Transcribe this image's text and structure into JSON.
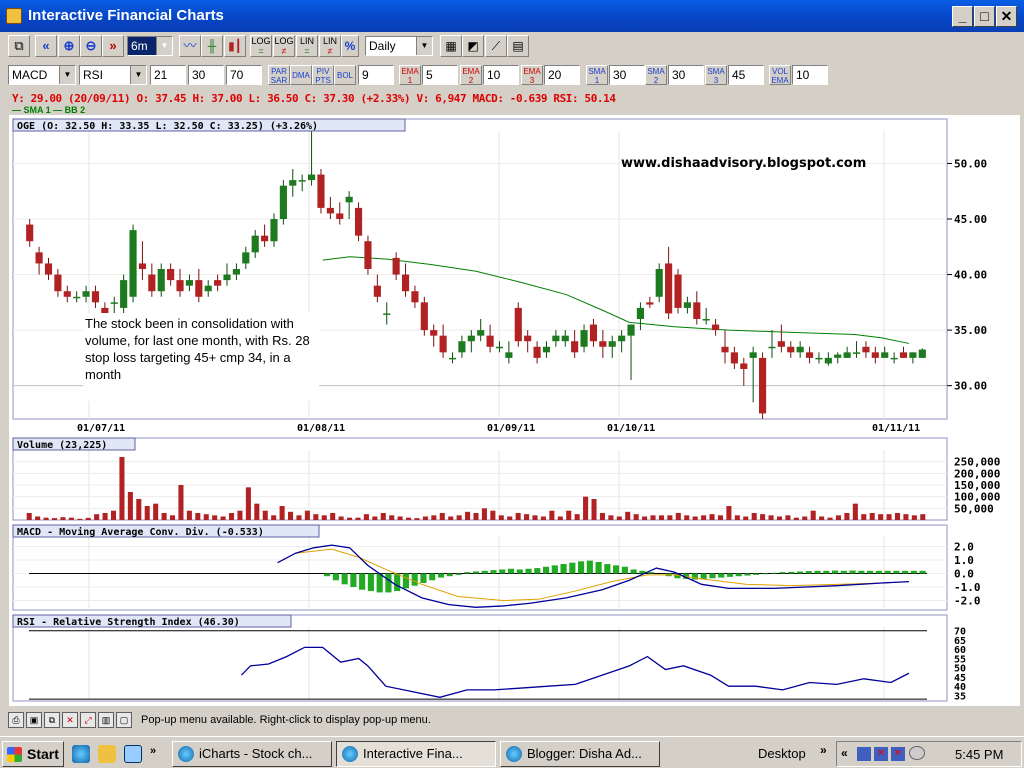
{
  "window": {
    "title": "Interactive Financial Charts"
  },
  "toolbar1": {
    "period": "6m",
    "frequency": "Daily",
    "log_label": "LOG",
    "lin_label": "LIN"
  },
  "toolbar2": {
    "indicator1": "MACD",
    "indicator2": "RSI",
    "macd_params": [
      "21",
      "30",
      "70"
    ],
    "par_sar": "PAR SAR",
    "dma": "DMA",
    "piv_pts": "PIV PTS",
    "bol": "BOL",
    "bol_value": "9",
    "ema1": "EMA 1",
    "ema1_value": "5",
    "ema2": "EMA 2",
    "ema2_value": "10",
    "ema3": "EMA 3",
    "ema3_value": "20",
    "sma1": "SMA 1",
    "sma1_value": "30",
    "sma2": "SMA 2",
    "sma2_value": "30",
    "sma3": "SMA 3",
    "sma3_value": "45",
    "vol_ema": "VOL EMA",
    "vol_ema_value": "10"
  },
  "quote_line": "Y: 29.00 (20/09/11) O: 37.45 H: 37.00 L: 36.50 C: 37.30 (+2.33%) V: 6,947 MACD: -0.639 RSI: 50.14",
  "ma_legend": "— SMA 1 — BB 2",
  "price_panel": {
    "label": "OGE (O: 32.50  H: 33.35  L: 32.50  C: 33.25) (+3.26%)",
    "annotation_url": "www.dishaadvisory.blogspot.com",
    "annotation_note": "The stock been in consolidation with volume, for last one month, with Rs. 28 stop loss targeting 45+ cmp 34, in a month",
    "y_ticks": [
      "50.00",
      "45.00",
      "40.00",
      "35.00",
      "30.00"
    ],
    "x_labels": [
      "01/07/11",
      "01/08/11",
      "01/09/11",
      "01/10/11",
      "01/11/11"
    ]
  },
  "volume_panel": {
    "label": "Volume (23,225)",
    "y_ticks": [
      "250,000",
      "200,000",
      "150,000",
      "100,000",
      "50,000"
    ]
  },
  "macd_panel": {
    "label": "MACD - Moving Average Conv. Div. (-0.533)",
    "y_ticks": [
      "2.0",
      "1.0",
      "0.0",
      "-1.0",
      "-2.0"
    ]
  },
  "rsi_panel": {
    "label": "RSI - Relative Strength Index (46.30)",
    "y_ticks": [
      "70",
      "65",
      "60",
      "55",
      "50",
      "45",
      "40",
      "35"
    ]
  },
  "statusbar": {
    "text": "Pop-up menu available. Right-click to display pop-up menu."
  },
  "taskbar": {
    "start": "Start",
    "tasks": [
      "iCharts - Stock ch...",
      "Interactive Fina...",
      "Blogger: Disha Ad..."
    ],
    "desktop": "Desktop",
    "clock": "5:45 PM"
  },
  "colors": {
    "up": "#1e7a1e",
    "down": "#b22222",
    "sma": "#008000",
    "macd": "#000099",
    "signal": "#e0a000",
    "rsi": "#000099"
  },
  "chart_data": [
    {
      "type": "candlestick",
      "title": "OGE",
      "ylim": [
        27,
        54
      ],
      "x_labels": [
        "01/07/11",
        "01/08/11",
        "01/09/11",
        "01/10/11",
        "01/11/11"
      ],
      "ohlc": [
        [
          44.5,
          45,
          42.5,
          43
        ],
        [
          42,
          42.5,
          40,
          41
        ],
        [
          41,
          41.5,
          39.5,
          40
        ],
        [
          40,
          40.5,
          38,
          38.5
        ],
        [
          38.5,
          39,
          37.5,
          38
        ],
        [
          38,
          38.5,
          37.5,
          38
        ],
        [
          38,
          39,
          37.5,
          38.5
        ],
        [
          38.5,
          39,
          37,
          37.5
        ],
        [
          37,
          37.5,
          36.2,
          36.5
        ],
        [
          37.5,
          38,
          36.5,
          37.5
        ],
        [
          37,
          40,
          36.5,
          39.5
        ],
        [
          38,
          44.5,
          37.5,
          44
        ],
        [
          41,
          43,
          39.5,
          40.5
        ],
        [
          40,
          41,
          38,
          38.5
        ],
        [
          38.5,
          41,
          38,
          40.5
        ],
        [
          40.5,
          41,
          39,
          39.5
        ],
        [
          39.5,
          40.5,
          38,
          38.5
        ],
        [
          39,
          40,
          38.5,
          39.5
        ],
        [
          39.5,
          40.5,
          37.5,
          38
        ],
        [
          38.5,
          39.5,
          38,
          39
        ],
        [
          39.5,
          40,
          38.5,
          39
        ],
        [
          39.5,
          41,
          39,
          40
        ],
        [
          40,
          41,
          39.5,
          40.5
        ],
        [
          41,
          42.5,
          40.5,
          42
        ],
        [
          42,
          44,
          41.5,
          43.5
        ],
        [
          43.5,
          44.5,
          42.5,
          43
        ],
        [
          43,
          45.5,
          42.5,
          45
        ],
        [
          45,
          48.5,
          44.5,
          48
        ],
        [
          48,
          49.5,
          47,
          48.5
        ],
        [
          48.5,
          49,
          47.5,
          48.5
        ],
        [
          48.5,
          53,
          48,
          49
        ],
        [
          49,
          49.5,
          45.5,
          46
        ],
        [
          46,
          47,
          45,
          45.5
        ],
        [
          45.5,
          46.5,
          44.5,
          45
        ],
        [
          46.5,
          47.5,
          45,
          47
        ],
        [
          46,
          46.5,
          43,
          43.5
        ],
        [
          43,
          43.5,
          40,
          40.5
        ],
        [
          39,
          40,
          37.5,
          38
        ],
        [
          36.5,
          37.5,
          35.5,
          36.5
        ],
        [
          41.5,
          42,
          39.5,
          40
        ],
        [
          40,
          41,
          38,
          38.5
        ],
        [
          38.5,
          39,
          37,
          37.5
        ],
        [
          37.5,
          38,
          34.5,
          35
        ],
        [
          35,
          35.5,
          33.5,
          34.5
        ],
        [
          34.5,
          35.5,
          32.5,
          33
        ],
        [
          32.5,
          33,
          32,
          32.5
        ],
        [
          33,
          34.5,
          32.5,
          34
        ],
        [
          34,
          35,
          33,
          34.5
        ],
        [
          34.5,
          36,
          34,
          35
        ],
        [
          34.5,
          35.5,
          33,
          33.5
        ],
        [
          33.5,
          34,
          33,
          33.5
        ],
        [
          32.5,
          34,
          32,
          33
        ],
        [
          37,
          37.5,
          33.5,
          34
        ],
        [
          34.5,
          35,
          33,
          34
        ],
        [
          33.5,
          34,
          32,
          32.5
        ],
        [
          33,
          34,
          32.5,
          33.5
        ],
        [
          34,
          35,
          33.5,
          34.5
        ],
        [
          34,
          35,
          33.5,
          34.5
        ],
        [
          34,
          35,
          32.5,
          33
        ],
        [
          33.5,
          35.5,
          33,
          35
        ],
        [
          35.5,
          36,
          33.5,
          34
        ],
        [
          34,
          35,
          32.5,
          33.5
        ],
        [
          33.5,
          34.5,
          32.5,
          34
        ],
        [
          34,
          35,
          33,
          34.5
        ],
        [
          34.5,
          35.5,
          30.5,
          35.5
        ],
        [
          36,
          37.5,
          35,
          37
        ],
        [
          37.5,
          38,
          37,
          37.3
        ],
        [
          38,
          41,
          37.5,
          40.5
        ],
        [
          41,
          42.5,
          36,
          36.5
        ],
        [
          40,
          40.5,
          36.5,
          37
        ],
        [
          37,
          38,
          36.5,
          37.5
        ],
        [
          37.5,
          38.5,
          35.5,
          36
        ],
        [
          36,
          37,
          35.5,
          36
        ],
        [
          35.5,
          36,
          34.5,
          35
        ],
        [
          33.5,
          35,
          32,
          33
        ],
        [
          33,
          33.5,
          31.5,
          32
        ],
        [
          32,
          32.5,
          30,
          31.5
        ],
        [
          32.5,
          33.5,
          28.5,
          33
        ],
        [
          32.5,
          33,
          27,
          27.5
        ],
        [
          33.5,
          35,
          32.5,
          33.5
        ],
        [
          34,
          35.5,
          33,
          33.5
        ],
        [
          33.5,
          34,
          32.5,
          33
        ],
        [
          33,
          34,
          32.5,
          33.5
        ],
        [
          33,
          33.5,
          32,
          32.5
        ],
        [
          32.5,
          33,
          32,
          32.5
        ],
        [
          32,
          33,
          31.8,
          32.5
        ],
        [
          32.5,
          33,
          32,
          32.8
        ],
        [
          32.5,
          33.5,
          32.5,
          33
        ],
        [
          33,
          34,
          32.5,
          33
        ],
        [
          33.5,
          34,
          32.5,
          33
        ],
        [
          33,
          33.5,
          32,
          32.5
        ],
        [
          32.5,
          33.5,
          32.5,
          33
        ],
        [
          32.5,
          33,
          32,
          32.5
        ],
        [
          33,
          33.5,
          32.5,
          32.5
        ],
        [
          32.5,
          33,
          32,
          33
        ],
        [
          32.5,
          33.35,
          32.5,
          33.25
        ]
      ],
      "sma": [
        [
          0.33,
          41.3
        ],
        [
          0.36,
          41.6
        ],
        [
          0.4,
          41.4
        ],
        [
          0.45,
          40.9
        ],
        [
          0.5,
          40.3
        ],
        [
          0.55,
          39.3
        ],
        [
          0.6,
          38.2
        ],
        [
          0.64,
          36.8
        ],
        [
          0.67,
          35.7
        ],
        [
          0.72,
          35.3
        ],
        [
          0.78,
          35.0
        ],
        [
          0.85,
          34.8
        ],
        [
          0.92,
          34.6
        ],
        [
          0.95,
          34.3
        ],
        [
          0.98,
          33.8
        ]
      ]
    },
    {
      "type": "bar",
      "title": "Volume",
      "ylim": [
        0,
        300000
      ],
      "values": [
        30000,
        15000,
        10000,
        8000,
        12000,
        10000,
        5000,
        9000,
        25000,
        30000,
        40000,
        270000,
        120000,
        90000,
        60000,
        70000,
        30000,
        20000,
        150000,
        40000,
        30000,
        25000,
        20000,
        15000,
        30000,
        40000,
        140000,
        70000,
        40000,
        20000,
        60000,
        35000,
        20000,
        40000,
        25000,
        20000,
        30000,
        15000,
        10000,
        10000,
        25000,
        15000,
        30000,
        20000,
        15000,
        10000,
        8000,
        15000,
        20000,
        30000,
        15000,
        20000,
        35000,
        30000,
        50000,
        40000,
        20000,
        15000,
        30000,
        25000,
        20000,
        15000,
        40000,
        15000,
        40000,
        25000,
        100000,
        90000,
        30000,
        20000,
        15000,
        35000,
        25000,
        15000,
        20000,
        20000,
        20000,
        30000,
        20000,
        15000,
        20000,
        25000,
        20000,
        60000,
        20000,
        15000,
        30000,
        25000,
        20000,
        15000,
        20000,
        10000,
        15000,
        40000,
        15000,
        10000,
        20000,
        30000,
        70000,
        25000,
        30000,
        25000,
        25000,
        30000,
        25000,
        20000,
        25000
      ]
    },
    {
      "type": "line",
      "title": "MACD",
      "ylim": [
        -2.7,
        2.7
      ],
      "macd": [
        [
          0.28,
          0.8
        ],
        [
          0.3,
          1.5
        ],
        [
          0.32,
          1.9
        ],
        [
          0.34,
          2.1
        ],
        [
          0.36,
          1.9
        ],
        [
          0.38,
          0.6
        ],
        [
          0.41,
          -0.8
        ],
        [
          0.44,
          -1.8
        ],
        [
          0.47,
          -2.3
        ],
        [
          0.5,
          -2.5
        ],
        [
          0.53,
          -2.4
        ],
        [
          0.56,
          -2.2
        ],
        [
          0.6,
          -1.8
        ],
        [
          0.64,
          -1.2
        ],
        [
          0.67,
          -0.5
        ],
        [
          0.7,
          0.4
        ],
        [
          0.72,
          0.1
        ],
        [
          0.75,
          -0.8
        ],
        [
          0.78,
          -1.1
        ],
        [
          0.83,
          -1.1
        ],
        [
          0.9,
          -0.9
        ],
        [
          0.95,
          -0.7
        ],
        [
          0.98,
          -0.6
        ]
      ],
      "signal": [
        [
          0.3,
          1.5
        ],
        [
          0.34,
          1.8
        ],
        [
          0.37,
          1.2
        ],
        [
          0.4,
          0.3
        ],
        [
          0.44,
          -0.8
        ],
        [
          0.48,
          -1.7
        ],
        [
          0.53,
          -2.0
        ],
        [
          0.57,
          -1.9
        ],
        [
          0.61,
          -1.3
        ],
        [
          0.65,
          -0.6
        ],
        [
          0.69,
          -0.1
        ],
        [
          0.72,
          -0.1
        ],
        [
          0.75,
          -0.4
        ],
        [
          0.8,
          -0.8
        ],
        [
          0.85,
          -0.9
        ],
        [
          0.9,
          -0.8
        ],
        [
          0.95,
          -0.7
        ],
        [
          0.98,
          -0.6
        ]
      ],
      "histogram": [
        0,
        0,
        0,
        0,
        0,
        0,
        0,
        0,
        0,
        0,
        0,
        0,
        0,
        0,
        0,
        0,
        0,
        0,
        0,
        0,
        0,
        0,
        0,
        0,
        0,
        0,
        0,
        0,
        0,
        0,
        0,
        0,
        0,
        0,
        -0.2,
        -0.5,
        -0.8,
        -1.0,
        -1.2,
        -1.3,
        -1.4,
        -1.4,
        -1.3,
        -1.1,
        -0.9,
        -0.7,
        -0.5,
        -0.3,
        -0.2,
        -0.1,
        0.1,
        0.15,
        0.2,
        0.25,
        0.3,
        0.35,
        0.3,
        0.35,
        0.4,
        0.5,
        0.6,
        0.7,
        0.8,
        0.9,
        0.95,
        0.85,
        0.7,
        0.6,
        0.5,
        0.3,
        0.2,
        0.1,
        0.0,
        -0.2,
        -0.35,
        -0.4,
        -0.45,
        -0.4,
        -0.35,
        -0.3,
        -0.25,
        -0.2,
        -0.15,
        -0.1,
        -0.05,
        0.05,
        0.1,
        0.12,
        0.15,
        0.18,
        0.2,
        0.2,
        0.22,
        0.2,
        0.22,
        0.2,
        0.2,
        0.2,
        0.2,
        0.2,
        0.2,
        0.2,
        0.2
      ]
    },
    {
      "type": "line",
      "title": "RSI",
      "ylim": [
        32,
        72
      ],
      "rsi": [
        [
          0.24,
          46
        ],
        [
          0.25,
          51
        ],
        [
          0.27,
          52
        ],
        [
          0.29,
          56
        ],
        [
          0.31,
          61
        ],
        [
          0.33,
          61
        ],
        [
          0.35,
          53
        ],
        [
          0.37,
          55
        ],
        [
          0.38,
          51
        ],
        [
          0.4,
          40
        ],
        [
          0.43,
          37
        ],
        [
          0.46,
          34
        ],
        [
          0.49,
          38
        ],
        [
          0.52,
          38
        ],
        [
          0.55,
          39
        ],
        [
          0.58,
          40
        ],
        [
          0.61,
          41
        ],
        [
          0.64,
          46
        ],
        [
          0.67,
          51
        ],
        [
          0.69,
          56
        ],
        [
          0.71,
          49
        ],
        [
          0.73,
          51
        ],
        [
          0.76,
          46
        ],
        [
          0.78,
          40
        ],
        [
          0.81,
          40
        ],
        [
          0.84,
          38
        ],
        [
          0.87,
          42
        ],
        [
          0.9,
          41
        ],
        [
          0.93,
          44
        ],
        [
          0.96,
          42
        ],
        [
          0.98,
          47
        ]
      ]
    }
  ]
}
